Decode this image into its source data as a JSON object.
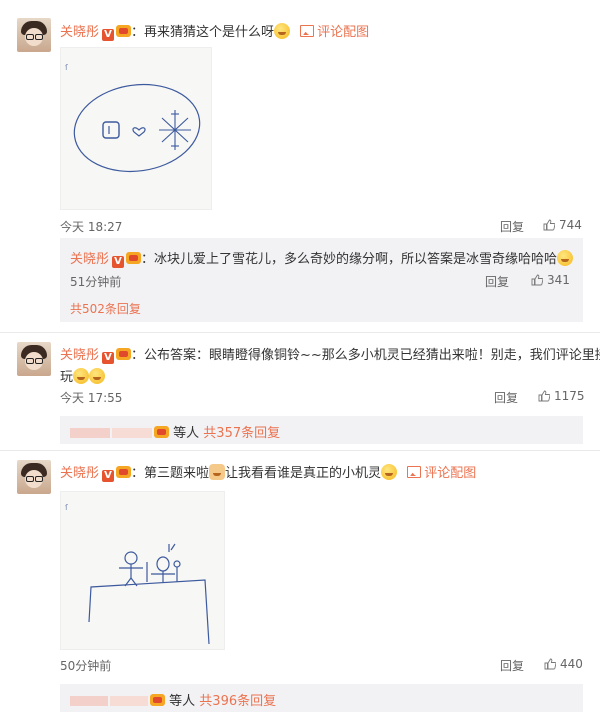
{
  "comment1": {
    "user": "关晓彤",
    "text": "：再来猜猜这个是什么呀",
    "pic_link": "评论配图",
    "time": "今天 18:27",
    "reply_label": "回复",
    "likes": "744",
    "sub": {
      "user": "关晓彤",
      "text": "：冰块儿爱上了雪花儿，多么奇妙的缘分啊，所以答案是冰雪奇缘哈哈哈",
      "time": "51分钟前",
      "reply_label": "回复",
      "likes": "341"
    },
    "more_replies": "共502条回复"
  },
  "comment2": {
    "user": "关晓彤",
    "text_line1": "：公布答案：眼睛瞪得像铜铃~~那么多小机灵已经猜出来啦！别走，我们评论里接着",
    "text_line2": "玩",
    "time": "今天 17:55",
    "reply_label": "回复",
    "likes": "1175",
    "others": "等人",
    "more_replies": "共357条回复"
  },
  "comment3": {
    "user": "关晓彤",
    "text_a": "：第三题来啦",
    "text_b": "让我看看谁是真正的小机灵",
    "pic_link": "评论配图",
    "time": "50分钟前",
    "reply_label": "回复",
    "likes": "440",
    "others": "等人",
    "more_replies": "共396条回复"
  }
}
